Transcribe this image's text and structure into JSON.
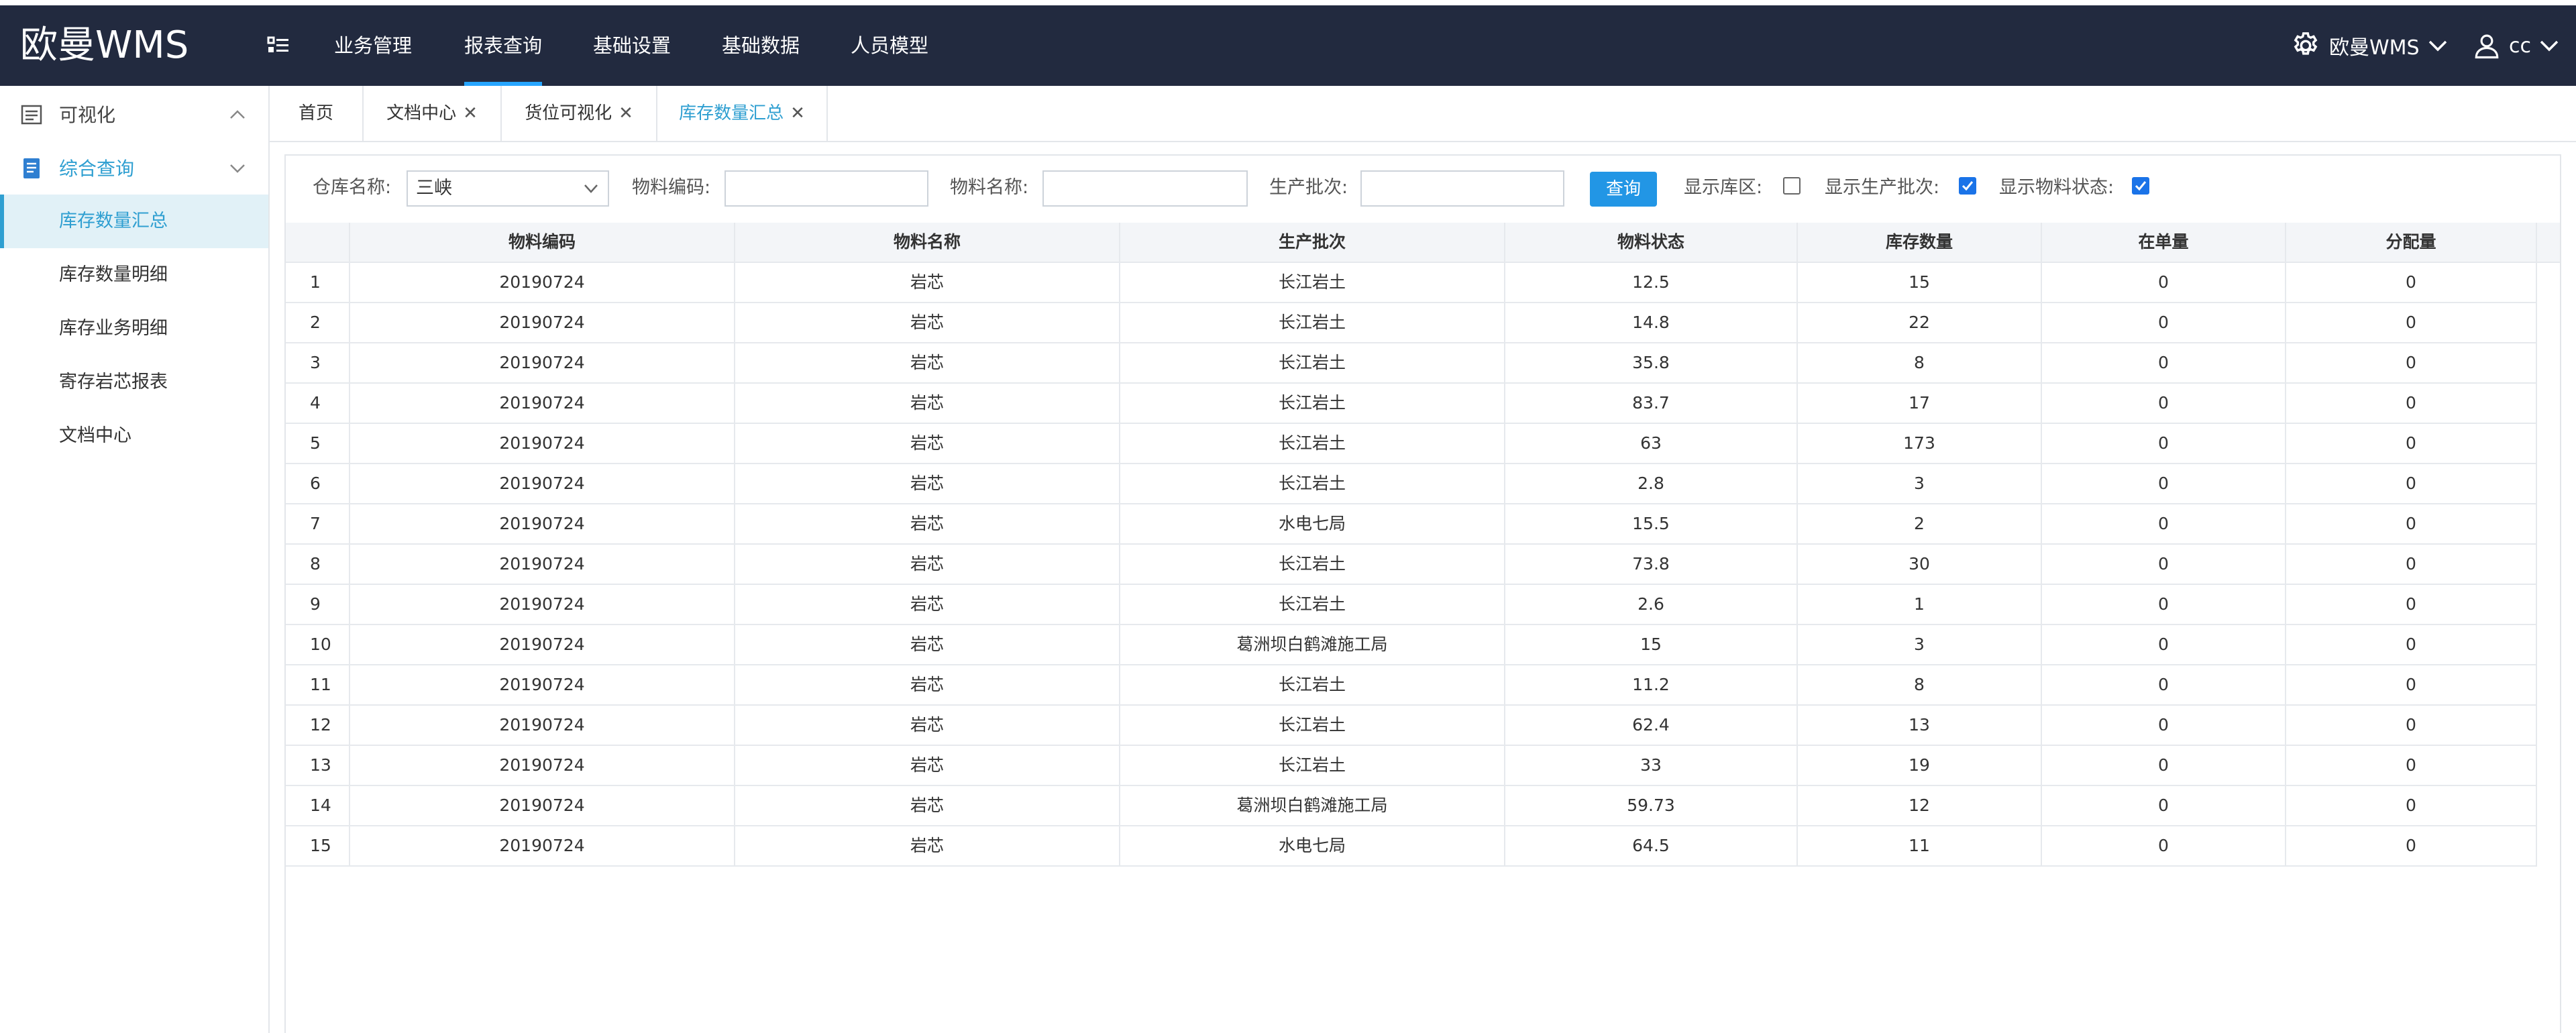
{
  "app": {
    "brand": "欧曼WMS"
  },
  "topnav": {
    "items": [
      "业务管理",
      "报表查询",
      "基础设置",
      "基础数据",
      "人员模型"
    ],
    "active_index": 1
  },
  "topright": {
    "system_label": "欧曼WMS",
    "user_label": "cc"
  },
  "sidebar": {
    "groups": [
      {
        "label": "可视化",
        "icon": "dashboard-icon",
        "expanded": false
      },
      {
        "label": "综合查询",
        "icon": "document-icon",
        "expanded": true
      }
    ],
    "items": [
      {
        "label": "库存数量汇总",
        "active": true
      },
      {
        "label": "库存数量明细",
        "active": false
      },
      {
        "label": "库存业务明细",
        "active": false
      },
      {
        "label": "寄存岩芯报表",
        "active": false
      },
      {
        "label": "文档中心",
        "active": false
      }
    ]
  },
  "tabs": [
    {
      "label": "首页",
      "closable": false,
      "active": false
    },
    {
      "label": "文档中心",
      "closable": true,
      "active": false
    },
    {
      "label": "货位可视化",
      "closable": true,
      "active": false
    },
    {
      "label": "库存数量汇总",
      "closable": true,
      "active": true
    }
  ],
  "filters": {
    "warehouse_label": "仓库名称:",
    "warehouse_value": "三峡",
    "material_code_label": "物料编码:",
    "material_code_value": "",
    "material_name_label": "物料名称:",
    "material_name_value": "",
    "batch_label": "生产批次:",
    "batch_value": "",
    "query_button": "查询",
    "show_area_label": "显示库区:",
    "show_area_checked": false,
    "show_batch_label": "显示生产批次:",
    "show_batch_checked": true,
    "show_status_label": "显示物料状态:",
    "show_status_checked": true
  },
  "table": {
    "columns": [
      "",
      "物料编码",
      "物料名称",
      "生产批次",
      "物料状态",
      "库存数量",
      "在单量",
      "分配量"
    ],
    "rows": [
      [
        "1",
        "20190724",
        "岩芯",
        "长江岩土",
        "12.5",
        "15",
        "0",
        "0"
      ],
      [
        "2",
        "20190724",
        "岩芯",
        "长江岩土",
        "14.8",
        "22",
        "0",
        "0"
      ],
      [
        "3",
        "20190724",
        "岩芯",
        "长江岩土",
        "35.8",
        "8",
        "0",
        "0"
      ],
      [
        "4",
        "20190724",
        "岩芯",
        "长江岩土",
        "83.7",
        "17",
        "0",
        "0"
      ],
      [
        "5",
        "20190724",
        "岩芯",
        "长江岩土",
        "63",
        "173",
        "0",
        "0"
      ],
      [
        "6",
        "20190724",
        "岩芯",
        "长江岩土",
        "2.8",
        "3",
        "0",
        "0"
      ],
      [
        "7",
        "20190724",
        "岩芯",
        "水电七局",
        "15.5",
        "2",
        "0",
        "0"
      ],
      [
        "8",
        "20190724",
        "岩芯",
        "长江岩土",
        "73.8",
        "30",
        "0",
        "0"
      ],
      [
        "9",
        "20190724",
        "岩芯",
        "长江岩土",
        "2.6",
        "1",
        "0",
        "0"
      ],
      [
        "10",
        "20190724",
        "岩芯",
        "葛洲坝白鹤滩施工局",
        "15",
        "3",
        "0",
        "0"
      ],
      [
        "11",
        "20190724",
        "岩芯",
        "长江岩土",
        "11.2",
        "8",
        "0",
        "0"
      ],
      [
        "12",
        "20190724",
        "岩芯",
        "长江岩土",
        "62.4",
        "13",
        "0",
        "0"
      ],
      [
        "13",
        "20190724",
        "岩芯",
        "长江岩土",
        "33",
        "19",
        "0",
        "0"
      ],
      [
        "14",
        "20190724",
        "岩芯",
        "葛洲坝白鹤滩施工局",
        "59.73",
        "12",
        "0",
        "0"
      ],
      [
        "15",
        "20190724",
        "岩芯",
        "水电七局",
        "64.5",
        "11",
        "0",
        "0"
      ]
    ]
  }
}
